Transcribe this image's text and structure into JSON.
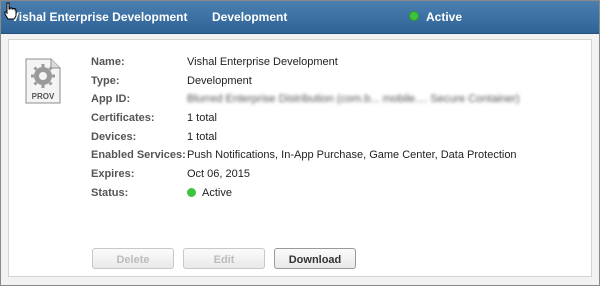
{
  "header": {
    "name": "Vishal Enterprise Development",
    "type": "Development",
    "status": "Active",
    "status_color": "#3cc43a",
    "background": "#3a6fa2"
  },
  "icon": {
    "label": "PROV",
    "name": "provisioning-profile-icon"
  },
  "details": {
    "name": {
      "label": "Name:",
      "value": "Vishal Enterprise Development"
    },
    "type": {
      "label": "Type:",
      "value": "Development"
    },
    "app_id": {
      "label": "App ID:",
      "value": "Blurred Enterprise Distribution (com.b... mobile.... Secure Container)"
    },
    "certificates": {
      "label": "Certificates:",
      "value": "1 total"
    },
    "devices": {
      "label": "Devices:",
      "value": "1 total"
    },
    "services": {
      "label": "Enabled Services:",
      "value": "Push Notifications, In-App Purchase, Game Center, Data Protection"
    },
    "expires": {
      "label": "Expires:",
      "value": "Oct 06, 2015"
    },
    "status": {
      "label": "Status:",
      "value": "Active"
    }
  },
  "buttons": {
    "delete": "Delete",
    "edit": "Edit",
    "download": "Download"
  }
}
